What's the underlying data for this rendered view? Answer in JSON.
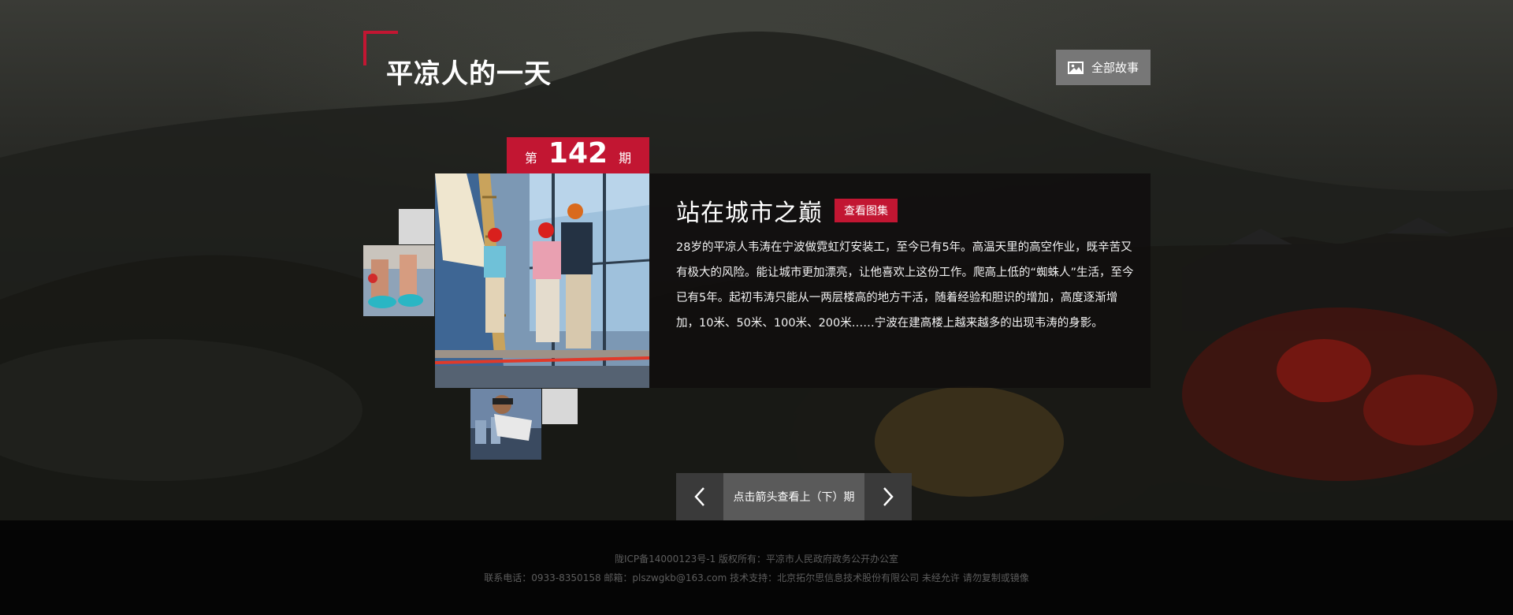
{
  "header": {
    "title": "平凉人的一天",
    "all_stories_label": "全部故事"
  },
  "issue": {
    "prefix": "第",
    "number": "142",
    "suffix": "期"
  },
  "story": {
    "title": "站在城市之巅",
    "gallery_label": "查看图集",
    "description": "28岁的平凉人韦涛在宁波做霓虹灯安装工，至今已有5年。高温天里的高空作业，既辛苦又有极大的风险。能让城市更加漂亮，让他喜欢上这份工作。爬高上低的“蜘蛛人”生活，至今已有5年。起初韦涛只能从一两层楼高的地方干活，随着经验和胆识的增加，高度逐渐增加，10米、50米、100米、200米……宁波在建高楼上越来越多的出现韦涛的身影。"
  },
  "pager": {
    "label": "点击箭头查看上（下）期"
  },
  "footer": {
    "line1": "陇ICP备14000123号-1 版权所有：平凉市人民政府政务公开办公室",
    "line2": "联系电话：0933-8350158 邮箱：plszwgkb@163.com 技术支持：北京拓尔思信息技术股份有限公司 未经允许 请勿复制或镜像"
  },
  "colors": {
    "accent": "#c21632",
    "button_gray": "#777777",
    "footer_bg": "#050505"
  }
}
